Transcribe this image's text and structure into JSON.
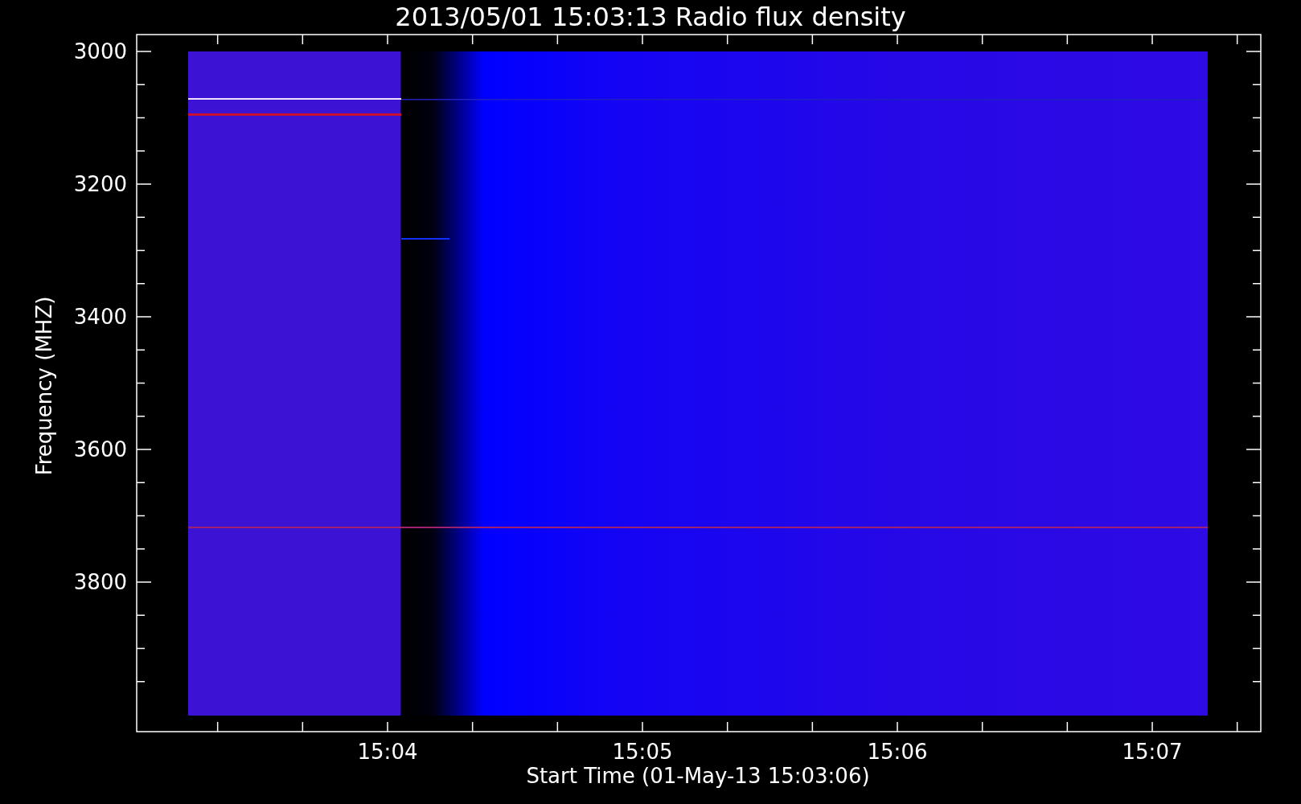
{
  "plot": {
    "title": "2013/05/01 15:03:13 Radio flux density",
    "ylabel": "Frequency (MHZ)",
    "xlabel": "Start Time (01-May-13 15:03:06)",
    "yticks": [
      "3000",
      "3200",
      "3400",
      "3600",
      "3800"
    ],
    "xticks": [
      "15:04",
      "15:05",
      "15:06",
      "15:07"
    ]
  }
}
